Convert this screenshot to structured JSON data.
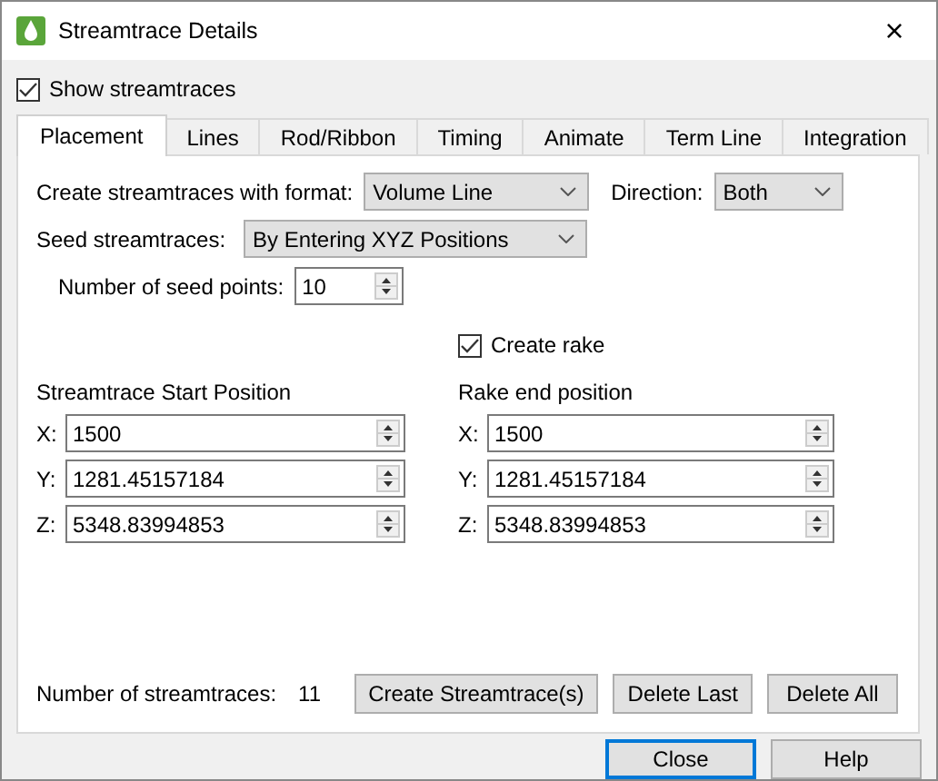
{
  "window": {
    "title": "Streamtrace Details",
    "close_button": "×"
  },
  "show_streamtraces": {
    "label": "Show streamtraces",
    "checked": true
  },
  "tabs": [
    {
      "label": "Placement",
      "selected": true
    },
    {
      "label": "Lines",
      "selected": false
    },
    {
      "label": "Rod/Ribbon",
      "selected": false
    },
    {
      "label": "Timing",
      "selected": false
    },
    {
      "label": "Animate",
      "selected": false
    },
    {
      "label": "Term Line",
      "selected": false
    },
    {
      "label": "Integration",
      "selected": false
    }
  ],
  "placement": {
    "format": {
      "label": "Create streamtraces with format:",
      "value": "Volume Line"
    },
    "direction": {
      "label": "Direction:",
      "value": "Both"
    },
    "seed": {
      "label": "Seed streamtraces:",
      "value": "By Entering XYZ Positions"
    },
    "seed_points": {
      "label": "Number of seed points:",
      "value": "10"
    },
    "create_rake": {
      "label": "Create rake",
      "checked": true
    },
    "groups": [
      {
        "title": "Streamtrace Start Position",
        "fields": [
          {
            "label": "X:",
            "value": "1500"
          },
          {
            "label": "Y:",
            "value": "1281.45157184"
          },
          {
            "label": "Z:",
            "value": "5348.83994853"
          }
        ]
      },
      {
        "title": "Rake end position",
        "fields": [
          {
            "label": "X:",
            "value": "1500"
          },
          {
            "label": "Y:",
            "value": "1281.45157184"
          },
          {
            "label": "Z:",
            "value": "5348.83994853"
          }
        ]
      }
    ],
    "count": {
      "label": "Number of streamtraces:",
      "value": "11"
    },
    "buttons": [
      "Create Streamtrace(s)",
      "Delete Last",
      "Delete All"
    ]
  },
  "footer_buttons": [
    {
      "label": "Close",
      "focused": true
    },
    {
      "label": "Help",
      "focused": false
    }
  ]
}
